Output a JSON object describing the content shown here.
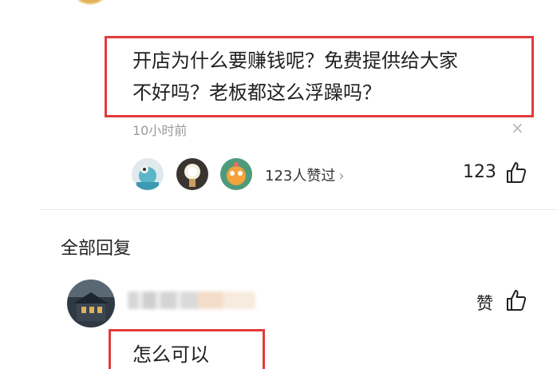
{
  "comment": {
    "line1": "开店为什么要赚钱呢？免费提供给大家",
    "line2": "不好吗？老板都这么浮躁吗？",
    "time": "10小时前",
    "close": "×"
  },
  "likes": {
    "summary": "123人赞过",
    "chevron": "›",
    "count": "123"
  },
  "replies": {
    "section_title": "全部回复",
    "items": [
      {
        "like_label": "赞",
        "text": "怎么可以"
      }
    ]
  },
  "icons": {
    "thumb": "thumbs-up-icon",
    "close": "close-icon"
  },
  "colors": {
    "highlight": "#e23b3b",
    "muted": "#9a9a9a"
  }
}
